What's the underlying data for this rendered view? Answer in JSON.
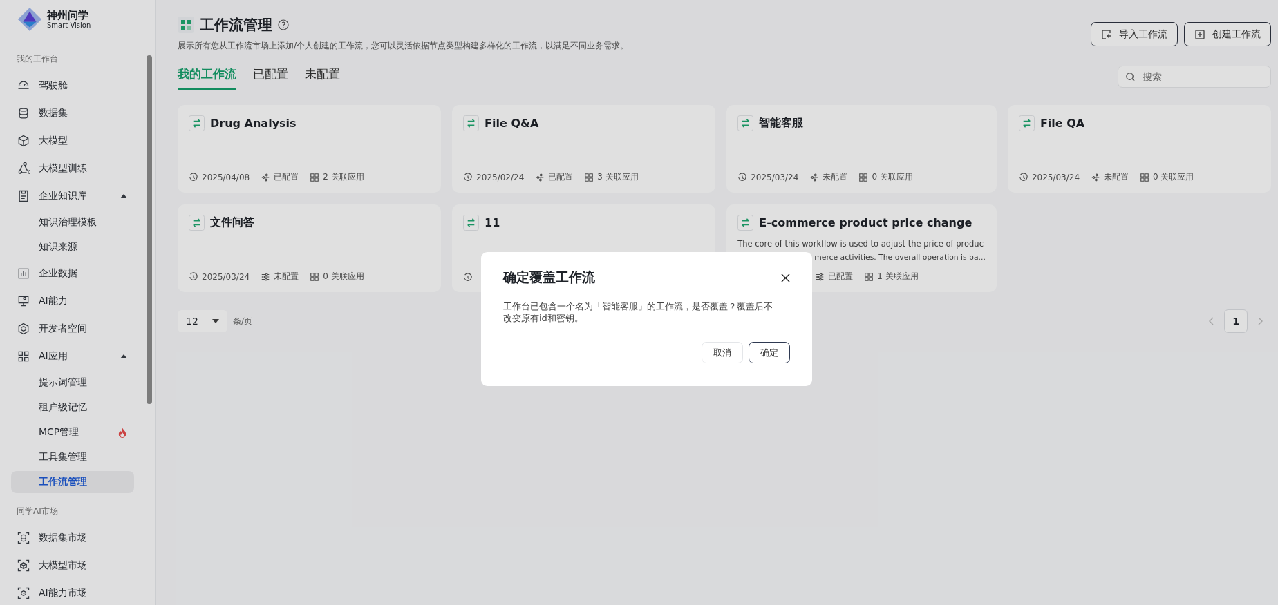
{
  "logo": {
    "name": "神州问学",
    "subtitle": "Smart Vision"
  },
  "sidebar": {
    "sections": [
      {
        "heading": "我的工作台",
        "items": [
          {
            "label": "驾驶舱",
            "selected": false
          },
          {
            "label": "数据集",
            "selected": false
          },
          {
            "label": "大模型",
            "selected": false
          },
          {
            "label": "大模型训练",
            "selected": false
          },
          {
            "label": "企业知识库",
            "selected": false,
            "expanded": true,
            "children": [
              {
                "label": "知识治理模板",
                "selected": false,
                "hot": false
              },
              {
                "label": "知识来源",
                "selected": false,
                "hot": false
              }
            ]
          },
          {
            "label": "企业数据",
            "selected": false
          },
          {
            "label": "AI能力",
            "selected": false
          },
          {
            "label": "开发者空间",
            "selected": false
          },
          {
            "label": "AI应用",
            "selected": false,
            "expanded": true,
            "children": [
              {
                "label": "提示词管理",
                "selected": false,
                "hot": false
              },
              {
                "label": "租户级记忆",
                "selected": false,
                "hot": false
              },
              {
                "label": "MCP管理",
                "selected": false,
                "hot": true
              },
              {
                "label": "工具集管理",
                "selected": false,
                "hot": false
              },
              {
                "label": "工作流管理",
                "selected": true,
                "hot": false
              }
            ]
          }
        ]
      },
      {
        "heading": "同学AI市场",
        "items": [
          {
            "label": "数据集市场",
            "selected": false
          },
          {
            "label": "大模型市场",
            "selected": false
          },
          {
            "label": "AI能力市场",
            "selected": false
          }
        ]
      }
    ]
  },
  "page": {
    "title": "工作流管理",
    "description": "展示所有您从工作流市场上添加/个人创建的工作流，您可以灵活依据节点类型构建多样化的工作流，以满足不同业务需求。",
    "buttons": [
      "导入工作流",
      "创建工作流"
    ]
  },
  "tabs": [
    {
      "label": "我的工作流",
      "selected": true
    },
    {
      "label": "已配置",
      "selected": false
    },
    {
      "label": "未配置",
      "selected": false
    }
  ],
  "search": {
    "placeholder": "搜索"
  },
  "cards": [
    {
      "title": "Drug Analysis",
      "date": "2025/04/08",
      "status": "已配置",
      "apps": "2 关联应用"
    },
    {
      "title": "File Q&A",
      "date": "2025/02/24",
      "status": "已配置",
      "apps": "3 关联应用"
    },
    {
      "title": "智能客服",
      "date": "2025/03/24",
      "status": "未配置",
      "apps": "0 关联应用"
    },
    {
      "title": "File QA",
      "date": "2025/03/24",
      "status": "未配置",
      "apps": "0 关联应用"
    },
    {
      "title": "文件问答",
      "date": "2025/03/24",
      "status": "未配置",
      "apps": "0 关联应用"
    },
    {
      "title": "11"
    },
    {
      "title": "E-commerce product price change",
      "description": [
        "The core of this workflow is used to adjust the price of produc",
        "merce activities. The overall operation is ba..."
      ],
      "status": "已配置",
      "apps": "1 关联应用"
    }
  ],
  "pagination": {
    "page_size": "12",
    "unit": "条/页",
    "pages": [
      {
        "label": "1",
        "selected": true
      }
    ]
  },
  "dialog": {
    "title": "确定覆盖工作流",
    "message": "工作台已包含一个名为「智能客服」的工作流，是否覆盖？覆盖后不改变原有id和密钥。",
    "buttons": [
      "取消",
      "确定"
    ]
  }
}
